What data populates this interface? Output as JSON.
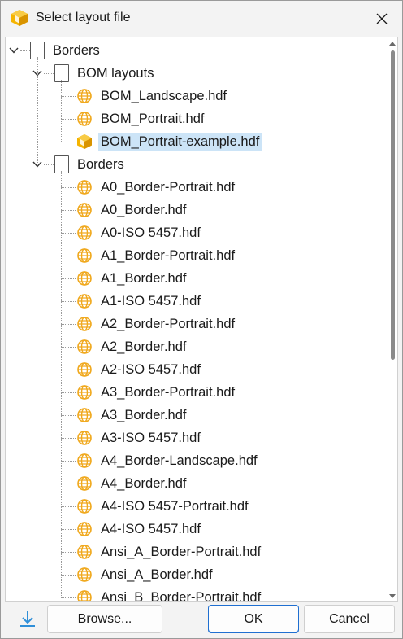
{
  "window": {
    "title": "Select layout file"
  },
  "tree": {
    "root": {
      "label": "Borders",
      "expanded": true
    },
    "groups": [
      {
        "label": "BOM layouts",
        "expanded": true,
        "items": [
          {
            "label": "BOM_Landscape.hdf",
            "icon": "globe-file-icon",
            "selected": false
          },
          {
            "label": "BOM_Portrait.hdf",
            "icon": "globe-file-icon",
            "selected": false
          },
          {
            "label": "BOM_Portrait-example.hdf",
            "icon": "app-file-icon",
            "selected": true
          }
        ]
      },
      {
        "label": "Borders",
        "expanded": true,
        "items": [
          {
            "label": "A0_Border-Portrait.hdf",
            "icon": "globe-file-icon"
          },
          {
            "label": "A0_Border.hdf",
            "icon": "globe-file-icon"
          },
          {
            "label": "A0-ISO 5457.hdf",
            "icon": "globe-file-icon"
          },
          {
            "label": "A1_Border-Portrait.hdf",
            "icon": "globe-file-icon"
          },
          {
            "label": "A1_Border.hdf",
            "icon": "globe-file-icon"
          },
          {
            "label": "A1-ISO 5457.hdf",
            "icon": "globe-file-icon"
          },
          {
            "label": "A2_Border-Portrait.hdf",
            "icon": "globe-file-icon"
          },
          {
            "label": "A2_Border.hdf",
            "icon": "globe-file-icon"
          },
          {
            "label": "A2-ISO 5457.hdf",
            "icon": "globe-file-icon"
          },
          {
            "label": "A3_Border-Portrait.hdf",
            "icon": "globe-file-icon"
          },
          {
            "label": "A3_Border.hdf",
            "icon": "globe-file-icon"
          },
          {
            "label": "A3-ISO 5457.hdf",
            "icon": "globe-file-icon"
          },
          {
            "label": "A4_Border-Landscape.hdf",
            "icon": "globe-file-icon"
          },
          {
            "label": "A4_Border.hdf",
            "icon": "globe-file-icon"
          },
          {
            "label": "A4-ISO 5457-Portrait.hdf",
            "icon": "globe-file-icon"
          },
          {
            "label": "A4-ISO 5457.hdf",
            "icon": "globe-file-icon"
          },
          {
            "label": "Ansi_A_Border-Portrait.hdf",
            "icon": "globe-file-icon"
          },
          {
            "label": "Ansi_A_Border.hdf",
            "icon": "globe-file-icon"
          },
          {
            "label": "Ansi_B_Border-Portrait.hdf",
            "icon": "globe-file-icon"
          }
        ]
      }
    ]
  },
  "footer": {
    "download_icon": "download-icon",
    "browse_label": "Browse...",
    "ok_label": "OK",
    "cancel_label": "Cancel"
  },
  "colors": {
    "selection": "#cce4f7",
    "accent": "#1f6fd1",
    "globe_icon": "#f0a81c",
    "app_icon": "#f5b400"
  }
}
